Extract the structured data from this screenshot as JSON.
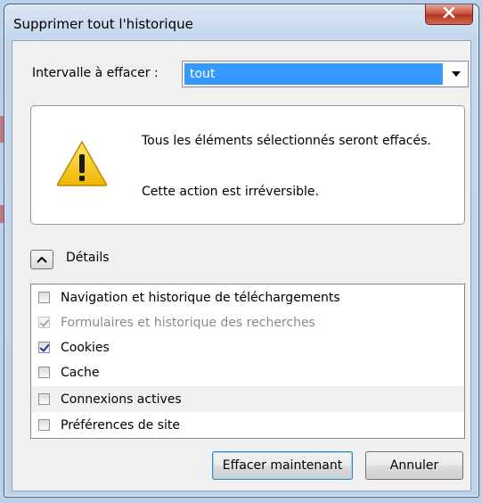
{
  "window": {
    "title": "Supprimer tout l'historique"
  },
  "interval": {
    "label": "Intervalle à effacer :",
    "selected": "tout"
  },
  "warning": {
    "line1": "Tous les éléments sélectionnés seront effacés.",
    "line2": "Cette action est irréversible."
  },
  "details": {
    "label": "Détails"
  },
  "items": [
    {
      "label": "Navigation et historique de téléchargements",
      "checked": false,
      "disabled": false
    },
    {
      "label": "Formulaires et historique des recherches",
      "checked": true,
      "disabled": true
    },
    {
      "label": "Cookies",
      "checked": true,
      "disabled": false
    },
    {
      "label": "Cache",
      "checked": false,
      "disabled": false
    },
    {
      "label": "Connexions actives",
      "checked": false,
      "disabled": false
    },
    {
      "label": "Préférences de site",
      "checked": false,
      "disabled": false
    }
  ],
  "buttons": {
    "clear_now": "Effacer maintenant",
    "cancel": "Annuler"
  },
  "icons": {
    "close": "close-icon",
    "dropdown": "chevron-down-icon",
    "warning": "warning-icon",
    "collapse": "chevron-up-icon"
  },
  "colors": {
    "selection": "#3399ff",
    "warning_yellow": "#f5c400",
    "close_red": "#c74a35"
  }
}
